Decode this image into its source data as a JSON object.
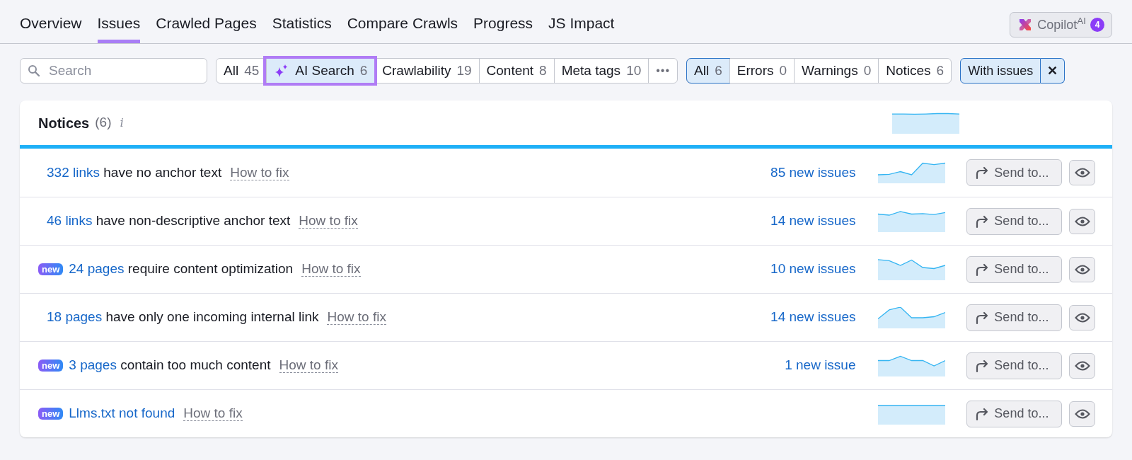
{
  "tabs": [
    {
      "label": "Overview",
      "selected": false
    },
    {
      "label": "Issues",
      "selected": true
    },
    {
      "label": "Crawled Pages",
      "selected": false
    },
    {
      "label": "Statistics",
      "selected": false
    },
    {
      "label": "Compare Crawls",
      "selected": false
    },
    {
      "label": "Progress",
      "selected": false
    },
    {
      "label": "JS Impact",
      "selected": false
    }
  ],
  "copilot": {
    "label": "Copilot$^{AI}$",
    "badge": "4"
  },
  "search": {
    "placeholder": "Search"
  },
  "categories": [
    {
      "label": "All",
      "count": "45",
      "selected": false,
      "kind": "plain"
    },
    {
      "label": "AI Search",
      "count": "6",
      "selected": true,
      "kind": "sparkle"
    },
    {
      "label": "Crawlability",
      "count": "19",
      "selected": false,
      "kind": "plain"
    },
    {
      "label": "Content",
      "count": "8",
      "selected": false,
      "kind": "plain"
    },
    {
      "label": "Meta tags",
      "count": "10",
      "selected": false,
      "kind": "plain"
    }
  ],
  "more_button": "•••",
  "severity": [
    {
      "label": "All",
      "count": "6",
      "selected": true
    },
    {
      "label": "Errors",
      "count": "0",
      "selected": false
    },
    {
      "label": "Warnings",
      "count": "0",
      "selected": false
    },
    {
      "label": "Notices",
      "count": "6",
      "selected": false
    }
  ],
  "with_issues": {
    "label": "With issues",
    "selected": true,
    "clear": "✕"
  },
  "panel": {
    "title": "Notices",
    "count": "(6)",
    "info": "i"
  },
  "issues": [
    {
      "is_new": false,
      "link": "332 links",
      "text": "have no anchor text",
      "how_to_fix": "How to fix",
      "new_issues": "85 new issues",
      "send": "Send to..."
    },
    {
      "is_new": false,
      "link": "46 links",
      "text": "have non-descriptive anchor text",
      "how_to_fix": "How to fix",
      "new_issues": "14 new issues",
      "send": "Send to..."
    },
    {
      "is_new": true,
      "badge": "new",
      "link": "24 pages",
      "text": "require content optimization",
      "how_to_fix": "How to fix",
      "new_issues": "10 new issues",
      "send": "Send to..."
    },
    {
      "is_new": false,
      "link": "18 pages",
      "text": "have only one incoming internal link",
      "how_to_fix": "How to fix",
      "new_issues": "14 new issues",
      "send": "Send to..."
    },
    {
      "is_new": true,
      "badge": "new",
      "link": "3 pages",
      "text": "contain too much content",
      "how_to_fix": "How to fix",
      "new_issues": "1 new issue",
      "send": "Send to..."
    },
    {
      "is_new": true,
      "badge": "new",
      "link": "Llms.txt not found",
      "how_to_fix": "How to fix",
      "send": "Send to..."
    }
  ]
}
